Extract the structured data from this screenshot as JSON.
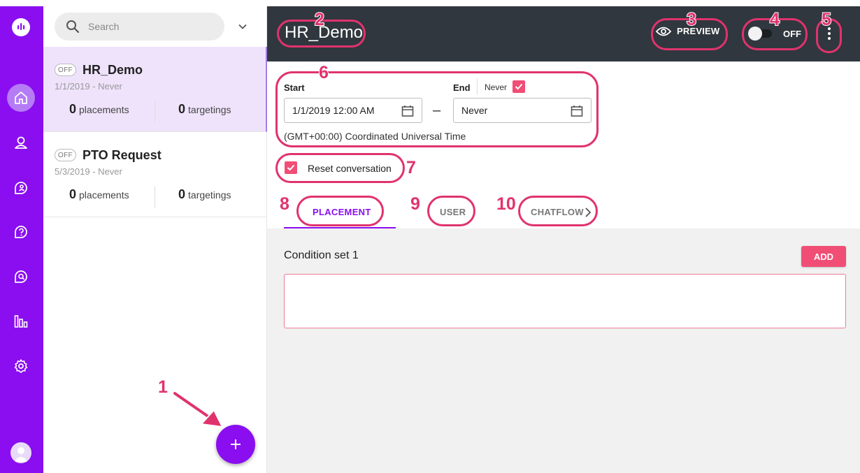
{
  "sidebar": {
    "nav_icons": [
      "chat-logo-icon",
      "home-icon",
      "user-icon",
      "chat-user-icon",
      "help-icon",
      "search-chat-icon",
      "analytics-icon",
      "settings-icon",
      "avatar-icon"
    ],
    "active_item": "home"
  },
  "list": {
    "search_placeholder": "Search",
    "items": [
      {
        "status": "OFF",
        "name": "HR_Demo",
        "dates": "1/1/2019 - Never",
        "placements_count": "0",
        "placements_label": "placements",
        "targetings_count": "0",
        "targetings_label": "targetings"
      },
      {
        "status": "OFF",
        "name": "PTO Request",
        "dates": "5/3/2019 - Never",
        "placements_count": "0",
        "placements_label": "placements",
        "targetings_count": "0",
        "targetings_label": "targetings"
      }
    ],
    "fab_label": "+"
  },
  "header": {
    "title": "HR_Demo",
    "preview_label": "PREVIEW",
    "toggle_label": "OFF"
  },
  "schedule": {
    "start_label": "Start",
    "start_value": "1/1/2019 12:00 AM",
    "end_label": "End",
    "never_label": "Never",
    "end_value": "Never",
    "dash": "–",
    "timezone": "(GMT+00:00) Coordinated Universal Time"
  },
  "reset": {
    "label": "Reset conversation"
  },
  "tabs": [
    {
      "label": "PLACEMENT"
    },
    {
      "label": "USER"
    },
    {
      "label": "CHATFLOW"
    }
  ],
  "condition": {
    "title": "Condition set 1",
    "add_label": "ADD"
  },
  "callouts": [
    "1",
    "2",
    "3",
    "4",
    "5",
    "6",
    "7",
    "8",
    "9",
    "10"
  ],
  "colors": {
    "brand_purple": "#8a0ef0",
    "accent_pink": "#f04e75",
    "header_dark": "#30373e",
    "callout_pink": "#e0336d"
  }
}
